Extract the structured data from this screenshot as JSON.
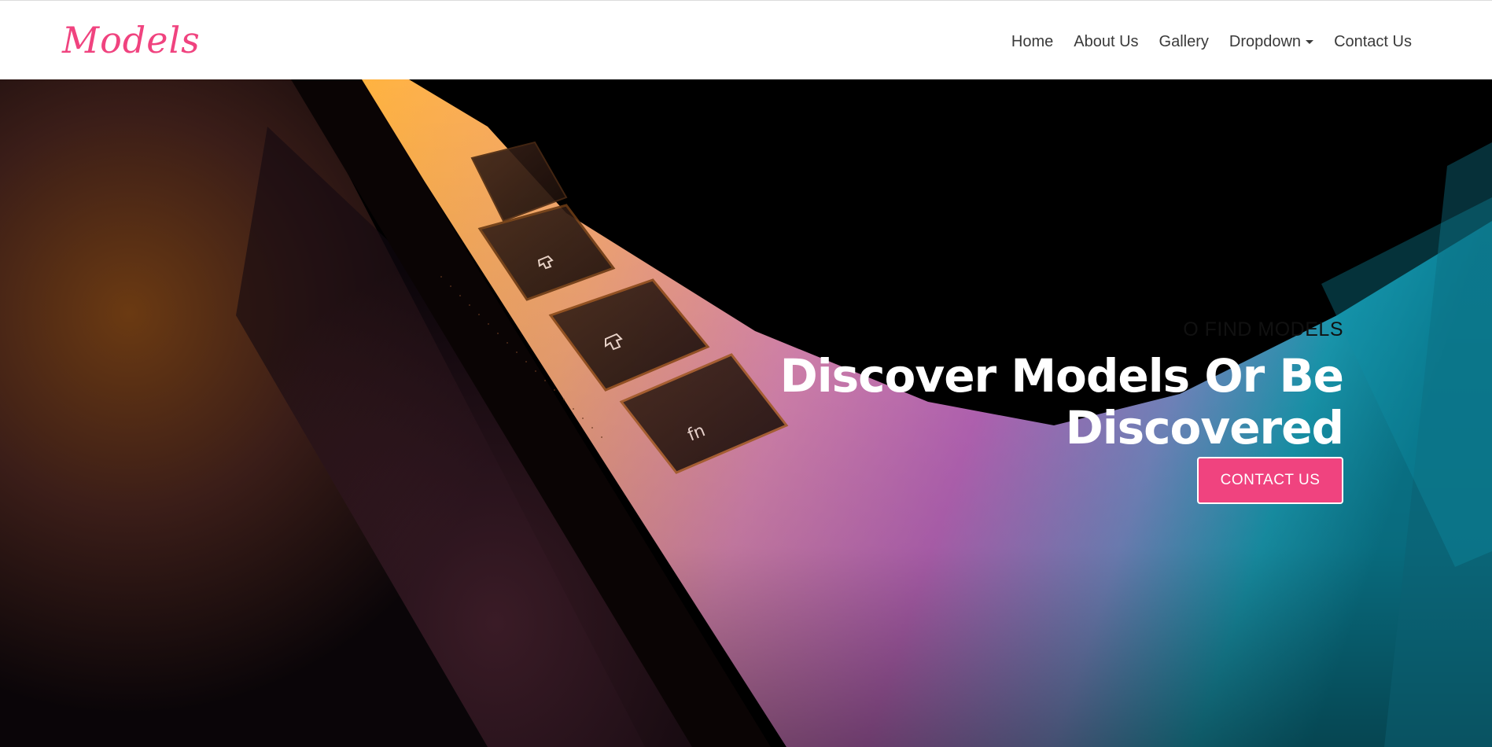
{
  "brand": {
    "logo_text": "Models",
    "accent_color": "#f0437f"
  },
  "nav": {
    "items": [
      {
        "label": "Home"
      },
      {
        "label": "About Us"
      },
      {
        "label": "Gallery"
      },
      {
        "label": "Dropdown",
        "has_caret": true
      },
      {
        "label": "Contact Us"
      }
    ]
  },
  "hero": {
    "eyebrow": "O FIND MODELS",
    "title_line1": "Discover Models Or Be",
    "title_line2": "Discovered",
    "cta_label": "CONTACT US",
    "background": "laptop keyboard close-up with orange, pink and teal light"
  }
}
